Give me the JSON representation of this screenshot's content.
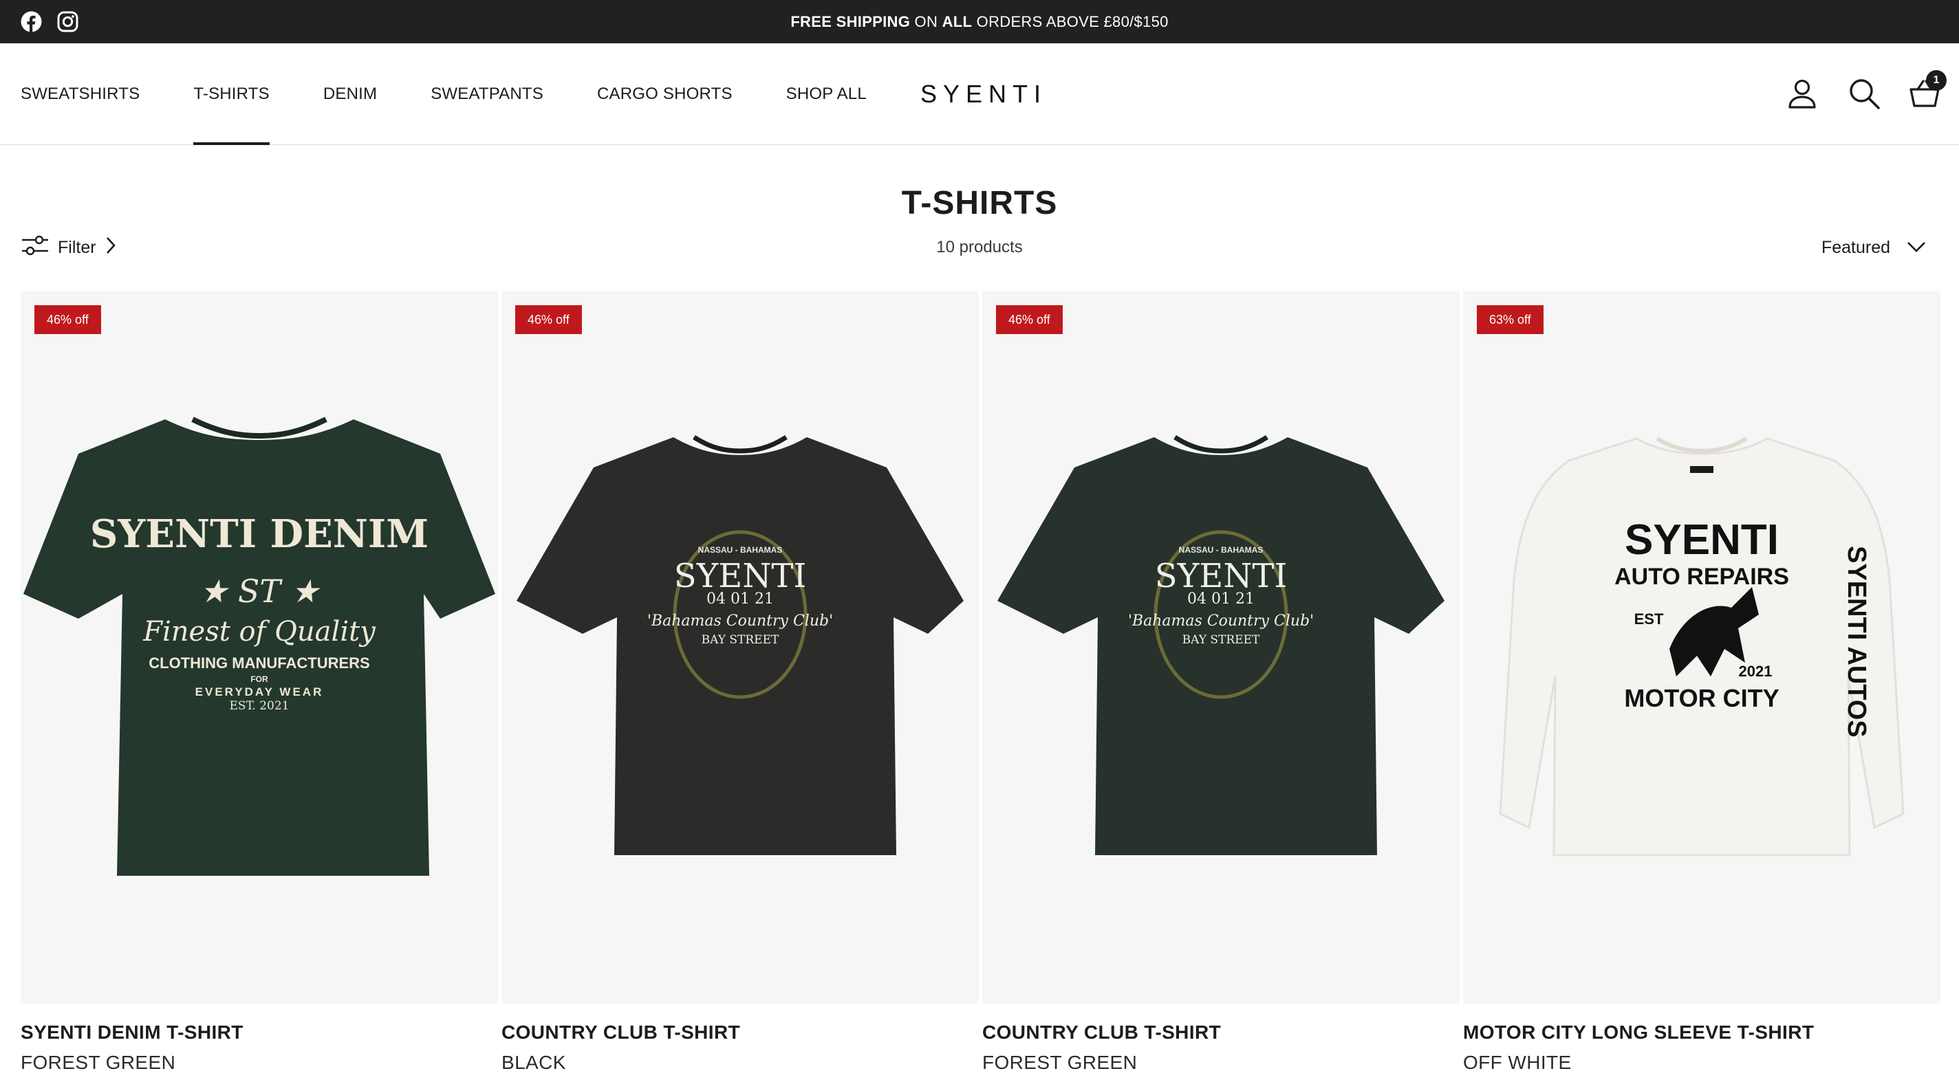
{
  "announcement": {
    "free_shipping": "FREE SHIPPING",
    "on": " ON ",
    "all": "ALL",
    "rest": " ORDERS ABOVE £80/$150",
    "social_icons": [
      "facebook-icon",
      "instagram-icon"
    ]
  },
  "header": {
    "nav": [
      {
        "label": "SWEATSHIRTS",
        "active": false
      },
      {
        "label": "T-SHIRTS",
        "active": true
      },
      {
        "label": "DENIM",
        "active": false
      },
      {
        "label": "SWEATPANTS",
        "active": false
      },
      {
        "label": "CARGO SHORTS",
        "active": false
      },
      {
        "label": "SHOP ALL",
        "active": false
      }
    ],
    "logo": "SYENTI",
    "cart_count": "1",
    "icons": [
      "account-icon",
      "search-icon",
      "cart-icon"
    ]
  },
  "collection": {
    "title": "T-SHIRTS",
    "count": "10 products",
    "filter_label": "Filter",
    "sort_label": "Featured"
  },
  "products": [
    {
      "badge": "46% off",
      "name": "SYENTI DENIM T-SHIRT",
      "color": "FOREST GREEN",
      "garment_color": "#24382d",
      "print": {
        "l1": "SYENTI DENIM",
        "l2": "Finest of Quality",
        "l3": "CLOTHING MANUFACTURERS",
        "l4": "FOR",
        "l5": "EVERYDAY WEAR",
        "l6": "EST. 2021"
      }
    },
    {
      "badge": "46% off",
      "name": "COUNTRY CLUB T-SHIRT",
      "color": "BLACK",
      "garment_color": "#2b2b2a",
      "print": {
        "l1": "NASSAU - BAHAMAS",
        "l2": "SYENTI",
        "l3": "04 01 21",
        "l4": "'Bahamas Country Club'",
        "l5": "BAY STREET"
      }
    },
    {
      "badge": "46% off",
      "name": "COUNTRY CLUB T-SHIRT",
      "color": "FOREST GREEN",
      "garment_color": "#26322b",
      "print": {
        "l1": "NASSAU - BAHAMAS",
        "l2": "SYENTI",
        "l3": "04 01 21",
        "l4": "'Bahamas Country Club'",
        "l5": "BAY STREET"
      }
    },
    {
      "badge": "63% off",
      "name": "MOTOR CITY LONG SLEEVE T-SHIRT",
      "color": "OFF WHITE",
      "garment_color": "#f4f3ef",
      "print": {
        "l1": "SYENTI",
        "l2": "AUTO REPAIRS",
        "l3": "EST",
        "l4": "2021",
        "l5": "MOTOR CITY",
        "sleeve": "SYENTI AUTOS"
      }
    }
  ]
}
